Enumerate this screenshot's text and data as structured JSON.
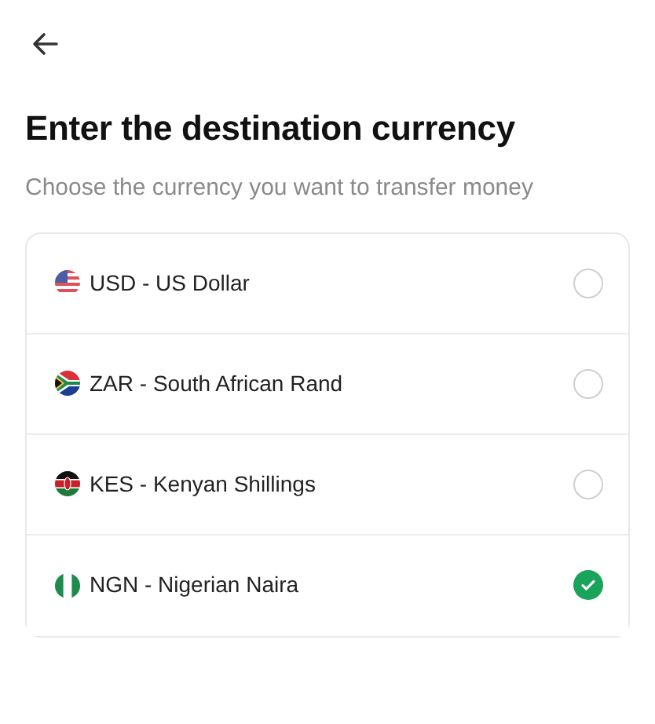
{
  "title": "Enter the destination currency",
  "subtitle": "Choose the currency you want to transfer money",
  "currencies": [
    {
      "kind": "us",
      "label": "USD - US Dollar",
      "selected": false
    },
    {
      "kind": "za",
      "label": "ZAR - South African Rand",
      "selected": false
    },
    {
      "kind": "ke",
      "label": "KES - Kenyan Shillings",
      "selected": false
    },
    {
      "kind": "ng",
      "label": "NGN - Nigerian Naira",
      "selected": true
    }
  ]
}
